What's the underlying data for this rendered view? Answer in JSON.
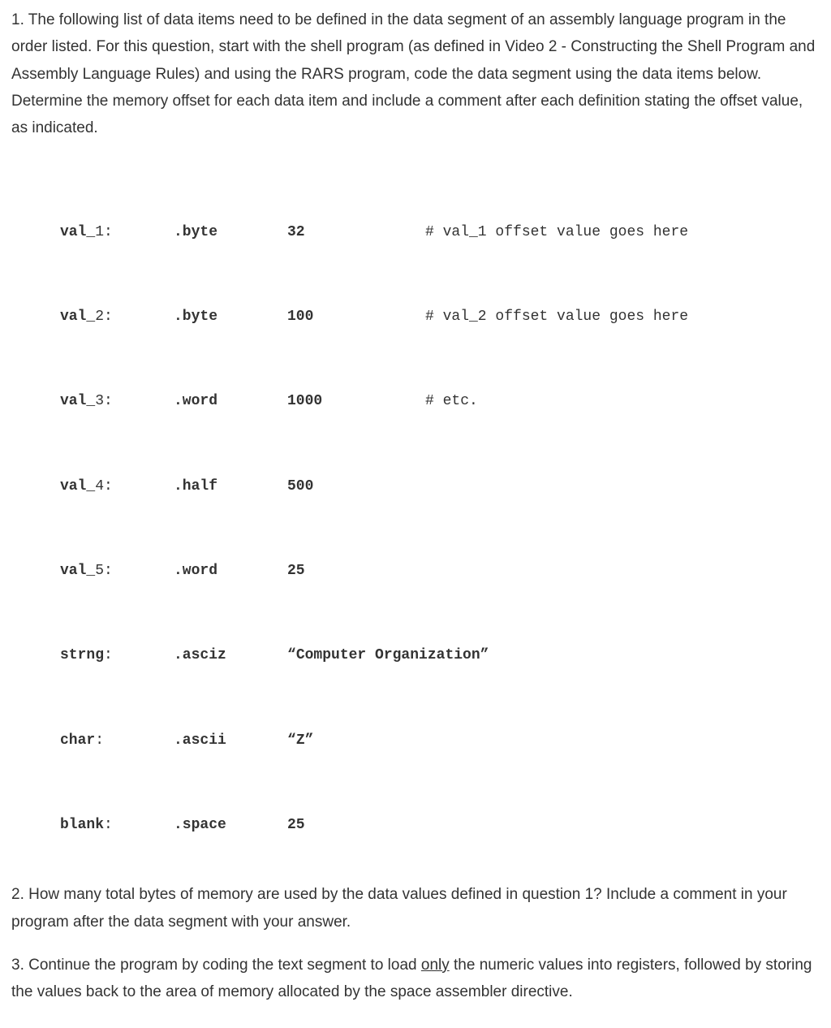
{
  "q1": {
    "number_prefix": "1.  ",
    "text": "The following list of data items need to be defined in the data segment of an assembly language program in the order listed.  For this question, start with the shell program (as defined in Video 2 - Constructing the Shell Program and Assembly Language Rules) and using the RARS program, code the data segment using the data items below.  Determine the memory offset for each data item and include a comment after each definition stating the offset value, as indicated."
  },
  "code": {
    "rows": [
      {
        "label_bold": "val",
        "label_tail": "_1:",
        "directive": ".byte",
        "value": "32",
        "quoted": false,
        "comment": "# val_1 offset value goes here"
      },
      {
        "label_bold": "val",
        "label_tail": "_2:",
        "directive": ".byte",
        "value": "100",
        "quoted": false,
        "comment": "# val_2 offset value goes here"
      },
      {
        "label_bold": "val",
        "label_tail": "_3:",
        "directive": ".word",
        "value": "1000",
        "quoted": false,
        "comment": "# etc."
      },
      {
        "label_bold": "val",
        "label_tail": "_4:",
        "directive": ".half",
        "value": "500",
        "quoted": false,
        "comment": ""
      },
      {
        "label_bold": "val",
        "label_tail": "_5:",
        "directive": ".word",
        "value": "25",
        "quoted": false,
        "comment": ""
      },
      {
        "label_bold": "strng",
        "label_tail": ":",
        "directive": ".asciz",
        "value": "Computer Organization",
        "quoted": true,
        "comment": ""
      },
      {
        "label_bold": "char",
        "label_tail": ":",
        "directive": ".ascii",
        "value": "Z",
        "quoted": true,
        "comment": ""
      },
      {
        "label_bold": "blank",
        "label_tail": ":",
        "directive": ".space",
        "value": "25",
        "quoted": false,
        "comment": ""
      }
    ]
  },
  "q2": {
    "number_prefix": "2.  ",
    "text": "How many total bytes of memory are used by the data values defined in question 1?  Include a comment in your program after the data segment with your answer."
  },
  "q3": {
    "number_prefix": "3.  ",
    "pre": "Continue the program by coding the text segment to load ",
    "underlined": "only",
    "post": " the numeric values into registers, followed by storing the values back to the area of memory allocated by the space assembler directive."
  }
}
